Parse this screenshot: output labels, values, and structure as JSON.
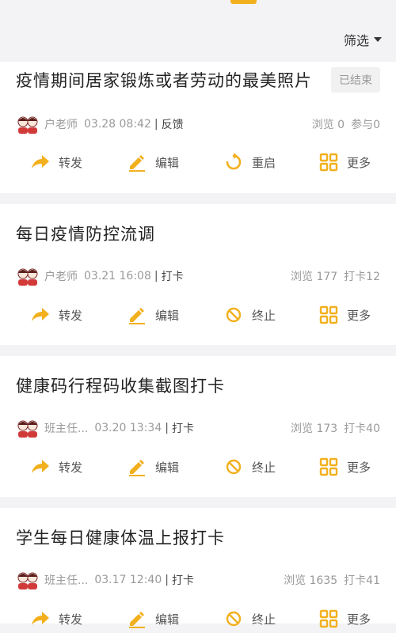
{
  "filter": {
    "label": "筛选"
  },
  "colors": {
    "accent": "#f2b01e",
    "background": "#f3f3f5"
  },
  "actions": {
    "forward": "转发",
    "edit": "编辑",
    "restart": "重启",
    "stop": "终止",
    "more": "更多"
  },
  "items": [
    {
      "title": "疫情期间居家锻炼或者劳动的最美照片",
      "badge": "已结束",
      "author": "户老师",
      "datetime": "03.28 08:42",
      "type": "反馈",
      "views": "浏览 0",
      "count": "参与0"
    },
    {
      "title": "每日疫情防控流调",
      "author": "户老师",
      "datetime": "03.21 16:08",
      "type": "打卡",
      "views": "浏览 177",
      "count": "打卡12"
    },
    {
      "title": "健康码行程码收集截图打卡",
      "author": "班主任...",
      "datetime": "03.20 13:34",
      "type": "打卡",
      "views": "浏览 173",
      "count": "打卡40"
    },
    {
      "title": "学生每日健康体温上报打卡",
      "author": "班主任...",
      "datetime": "03.17 12:40",
      "type": "打卡",
      "views": "浏览 1635",
      "count": "打卡41"
    }
  ]
}
